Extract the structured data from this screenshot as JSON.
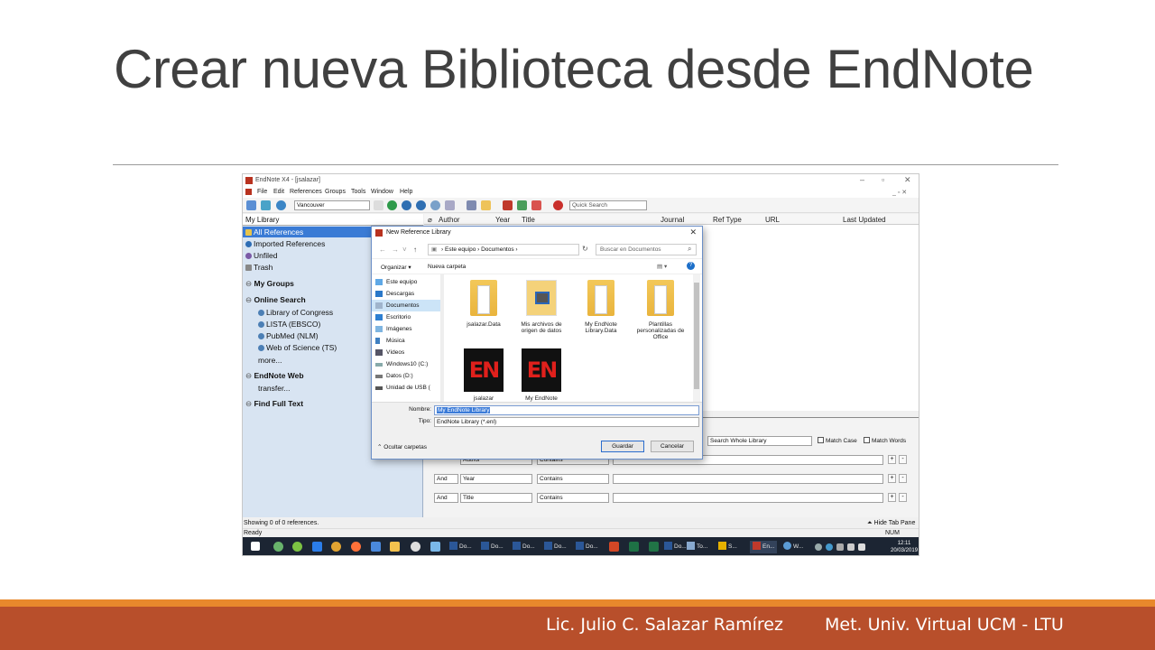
{
  "slide": {
    "title": "Crear nueva Biblioteca desde EndNote",
    "footer_author": "Lic. Julio C. Salazar Ramírez",
    "footer_course": "Met. Univ. Virtual UCM - LTU"
  },
  "colors": {
    "title": "#404040",
    "footer_bar": "#b84f2b",
    "footer_accent": "#e8882c",
    "selection": "#3a7bd5",
    "taskbar": "#1c2533"
  },
  "app": {
    "window_title": "EndNote X4 - [jsalazar]",
    "menu": [
      "File",
      "Edit",
      "References",
      "Groups",
      "Tools",
      "Window",
      "Help"
    ],
    "style": "Vancouver",
    "quick_search": "Quick Search",
    "library_name": "My Library",
    "groups": {
      "all_references": "All References",
      "imported_references": "Imported References",
      "unfiled": "Unfiled",
      "trash": "Trash",
      "my_groups": "My Groups",
      "online_search": "Online Search",
      "online_items": [
        "Library of Congress",
        "LISTA (EBSCO)",
        "PubMed (NLM)",
        "Web of Science (TS)"
      ],
      "more": "more...",
      "endnote_web": "EndNote Web",
      "transfer": "transfer...",
      "find_full_text": "Find Full Text"
    },
    "columns": [
      "Author",
      "Year",
      "Title",
      "Journal",
      "Ref Type",
      "URL",
      "Last Updated"
    ],
    "search_panel": {
      "scope": "Search Whole Library",
      "match_case": "Match Case",
      "match_words": "Match Words",
      "rows": [
        {
          "bool": "",
          "field": "Author",
          "op": "Contains"
        },
        {
          "bool": "And",
          "field": "Year",
          "op": "Contains"
        },
        {
          "bool": "And",
          "field": "Title",
          "op": "Contains"
        }
      ]
    },
    "status_count": "Showing 0 of 0 references.",
    "status_ready": "Ready",
    "hide_tab_pane": "Hide Tab Pane",
    "num": "NUM"
  },
  "dialog": {
    "title": "New Reference Library",
    "path": [
      "Este equipo",
      "Documentos"
    ],
    "search_placeholder": "Buscar en Documentos",
    "organize": "Organizar",
    "new_folder": "Nueva carpeta",
    "nav_items": [
      "Este equipo",
      "Descargas",
      "Documentos",
      "Escritorio",
      "Imágenes",
      "Música",
      "Vídeos",
      "Windows10 (C:)",
      "Datos (D:)",
      "Unidad de USB ("
    ],
    "files": [
      {
        "name": "jsalazar.Data",
        "icon": "folder-icon"
      },
      {
        "name": "Mis archivos de origen de datos",
        "icon": "data-source-folder-icon"
      },
      {
        "name": "My EndNote Library.Data",
        "icon": "folder-icon"
      },
      {
        "name": "Plantillas personalizadas de Office",
        "icon": "folder-icon"
      },
      {
        "name": "jsalazar",
        "icon": "endnote-library-icon"
      },
      {
        "name": "My EndNote",
        "icon": "endnote-library-icon"
      }
    ],
    "name_label": "Nombre:",
    "name_value": "My EndNote Library",
    "type_label": "Tipo:",
    "type_value": "EndNote Library (*.enl)",
    "hide_folders": "Ocultar carpetas",
    "save": "Guardar",
    "cancel": "Cancelar"
  },
  "taskbar": {
    "items": [
      "Do...",
      "Do...",
      "Do...",
      "Do...",
      "Do...",
      "Do...",
      "To...",
      "S...",
      "En...",
      "W..."
    ],
    "time": "12:11",
    "date": "20/03/2019"
  }
}
